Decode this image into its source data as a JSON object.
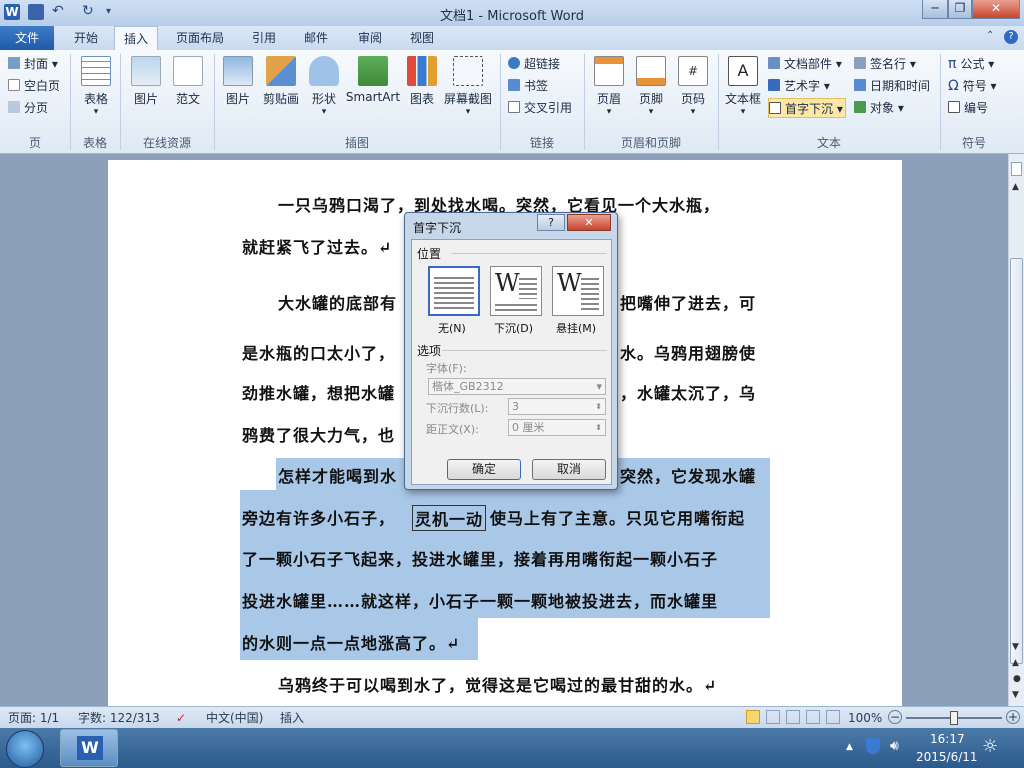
{
  "window": {
    "title": "文档1 - Microsoft Word",
    "app_icon_letter": "W",
    "min": "─",
    "restore": "❐",
    "close": "✕"
  },
  "tabs": [
    "文件",
    "开始",
    "插入",
    "页面布局",
    "引用",
    "邮件",
    "审阅",
    "视图"
  ],
  "ribbon": {
    "pages_group": {
      "items": [
        "封面",
        "空白页",
        "分页"
      ],
      "label": "页"
    },
    "table_group": {
      "btn": "表格",
      "label": "表格"
    },
    "online_group": {
      "btns": [
        "图片",
        "范文"
      ],
      "label": "在线资源"
    },
    "illustrations_group": {
      "btns": [
        "图片",
        "剪贴画",
        "形状",
        "SmartArt",
        "图表",
        "屏幕截图"
      ],
      "label": "插图"
    },
    "links_group": {
      "items": [
        "超链接",
        "书签",
        "交叉引用"
      ],
      "label": "链接"
    },
    "header_footer_group": {
      "btns": [
        "页眉",
        "页脚",
        "页码"
      ],
      "label": "页眉和页脚"
    },
    "text_group": {
      "big": "文本框",
      "items": [
        "文档部件",
        "艺术字",
        "首字下沉"
      ],
      "items2": [
        "签名行",
        "日期和时间",
        "对象"
      ],
      "label": "文本"
    },
    "symbols_group": {
      "items": [
        "公式",
        "符号",
        "编号"
      ],
      "label": "符号"
    }
  },
  "document": {
    "lines": [
      "一只乌鸦口渴了，到处找水喝。突然，它看见一个大水瓶，",
      "就赶紧飞了过去。↵",
      "大水罐的底部有",
      "把嘴伸了进去，可",
      "是水瓶的口太小了，",
      "水。乌鸦用翅膀使",
      "劲推水罐，想把水罐",
      "，水罐太沉了，乌",
      "鸦费了很大力气，也",
      "怎样才能喝到水",
      "突然，它发现水罐",
      "旁边有许多小石子，",
      "灵机一动",
      "使马上有了主意。只见它用嘴衔起",
      "了一颗小石子飞起来，投进水罐里，接着再用嘴衔起一颗小石子",
      "投进水罐里……就这样，小石子一颗一颗地被投进去，而水罐里",
      "的水则一点一点地涨高了。↵",
      "乌鸦终于可以喝到水了，觉得这是它喝过的最甘甜的水。↵"
    ]
  },
  "dialog": {
    "title": "首字下沉",
    "help": "?",
    "close": "✕",
    "position_label": "位置",
    "options": [
      {
        "label": "无(N)",
        "glyph": "W"
      },
      {
        "label": "下沉(D)",
        "glyph": "W"
      },
      {
        "label": "悬挂(M)",
        "glyph": "W"
      }
    ],
    "options_label": "选项",
    "font_label": "字体(F):",
    "font_value": "楷体_GB2312",
    "lines_label": "下沉行数(L):",
    "lines_value": "3",
    "distance_label": "距正文(X):",
    "distance_value": "0 厘米",
    "ok": "确定",
    "cancel": "取消"
  },
  "status": {
    "page": "页面: 1/1",
    "words": "字数: 122/313",
    "lang": "中文(中国)",
    "mode": "插入",
    "zoom": "100%"
  },
  "taskbar": {
    "time": "16:17",
    "date": "2015/6/11"
  }
}
